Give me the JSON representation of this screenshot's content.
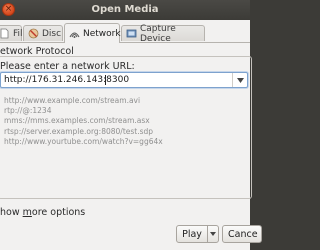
{
  "window": {
    "title": "Open Media"
  },
  "tabs": [
    {
      "label": "File",
      "icon": "file-icon"
    },
    {
      "label": "Disc",
      "icon": "disc-icon"
    },
    {
      "label": "Network",
      "icon": "network-icon",
      "active": true
    },
    {
      "label": "Capture Device",
      "icon": "capture-device-icon"
    }
  ],
  "network": {
    "section_label": "etwork Protocol",
    "url_label": "Please enter a network URL:",
    "url_value": "http://176.31.246.143:8300",
    "examples": [
      "http://www.example.com/stream.avi",
      "rtp://@:1234",
      "mms://mms.examples.com/stream.asx",
      "rtsp://server.example.org:8080/test.sdp",
      "http://www.yourtube.com/watch?v=gg64x"
    ]
  },
  "footer": {
    "show_more_label": "how more options",
    "show_more_underline": "m",
    "play_label": "Play",
    "cancel_label": "Cance"
  },
  "colors": {
    "titlebar": "#3c3b37",
    "dialog_bg": "#f2f1f0",
    "close_button": "#e25a2b",
    "focus_ring": "#7da2ce",
    "example_text": "#8f8f8f"
  }
}
